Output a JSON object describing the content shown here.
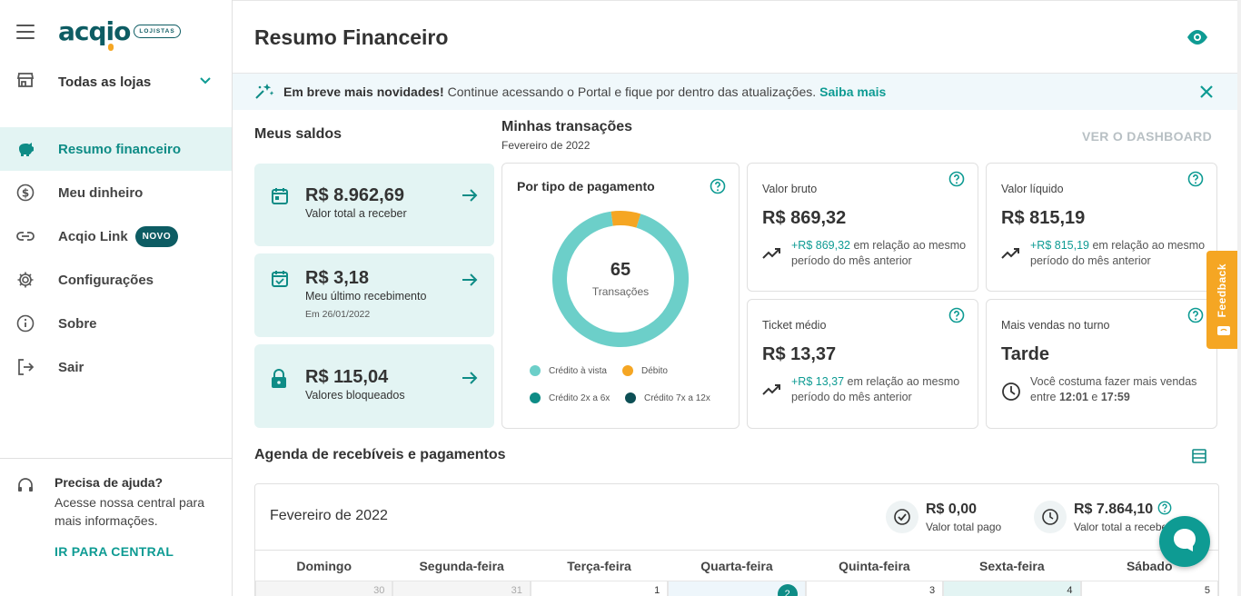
{
  "brand": {
    "name": "acqio",
    "tag": "LOJISTAS"
  },
  "store_selector": {
    "label": "Todas as lojas"
  },
  "nav": [
    {
      "label": "Resumo financeiro",
      "icon": "piggy-bank-icon",
      "active": true
    },
    {
      "label": "Meu dinheiro",
      "icon": "dollar-circle-icon"
    },
    {
      "label": "Acqio Link",
      "icon": "link-icon",
      "badge": "NOVO"
    },
    {
      "label": "Configurações",
      "icon": "gear-icon"
    },
    {
      "label": "Sobre",
      "icon": "info-icon"
    },
    {
      "label": "Sair",
      "icon": "logout-icon"
    }
  ],
  "help": {
    "title": "Precisa de ajuda?",
    "text": "Acesse nossa central para mais informações.",
    "link": "IR PARA CENTRAL"
  },
  "header": {
    "title": "Resumo Financeiro"
  },
  "banner": {
    "bold": "Em breve mais novidades!",
    "text": "Continue acessando o Portal e fique por dentro das atualizações.",
    "link": "Saiba mais"
  },
  "saldos": {
    "title": "Meus saldos",
    "cards": [
      {
        "amount": "R$ 8.962,69",
        "label": "Valor total a receber"
      },
      {
        "amount": "R$ 3,18",
        "label": "Meu último recebimento",
        "date": "Em 26/01/2022"
      },
      {
        "amount": "R$ 115,04",
        "label": "Valores bloqueados"
      }
    ]
  },
  "transacoes": {
    "title": "Minhas transações",
    "period": "Fevereiro de 2022",
    "dashboard_link": "VER O DASHBOARD"
  },
  "pie": {
    "title": "Por tipo de pagamento",
    "total": "65",
    "total_label": "Transações",
    "legend": [
      "Crédito à vista",
      "Débito",
      "Crédito 2x a 6x",
      "Crédito 7x a 12x"
    ],
    "colors": [
      "#6ccfc9",
      "#f5a623",
      "#0e8c86",
      "#0d4f55"
    ],
    "shares": [
      0.93,
      0.07,
      0,
      0
    ]
  },
  "kpis": {
    "bruto": {
      "label": "Valor bruto",
      "value": "R$ 869,32",
      "delta": "+R$ 869,32",
      "text": " em relação ao mesmo período do mês anterior"
    },
    "liquido": {
      "label": "Valor líquido",
      "value": "R$ 815,19",
      "delta": "+R$ 815,19",
      "text": " em relação ao mesmo período do mês anterior"
    },
    "ticket": {
      "label": "Ticket médio",
      "value": "R$ 13,37",
      "delta": "+R$ 13,37",
      "text": " em relação ao mesmo período do mês anterior"
    },
    "turno": {
      "label": "Mais vendas no turno",
      "value": "Tarde",
      "text_a": "Você costuma fazer mais vendas entre ",
      "from": "12:01",
      "e": " e ",
      "to": "17:59"
    }
  },
  "agenda": {
    "title": "Agenda de recebíveis e pagamentos",
    "month": "Fevereiro de 2022",
    "pago": {
      "amount": "R$ 0,00",
      "label": "Valor total pago"
    },
    "receber": {
      "amount": "R$ 7.864,10",
      "label": "Valor total a receber"
    },
    "weekdays": [
      "Domingo",
      "Segunda-feira",
      "Terça-feira",
      "Quarta-feira",
      "Quinta-feira",
      "Sexta-feira",
      "Sábado"
    ],
    "days": [
      "30",
      "31",
      "1",
      "2",
      "3",
      "4",
      "5"
    ]
  },
  "feedback": "Feedback"
}
